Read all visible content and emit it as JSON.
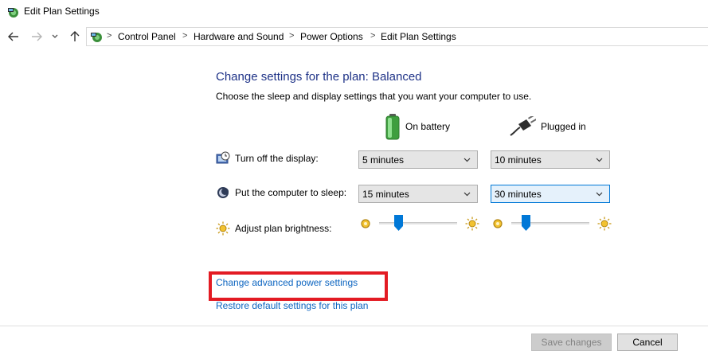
{
  "window": {
    "title": "Edit Plan Settings"
  },
  "nav": {
    "back_icon": "arrow-left-icon",
    "forward_icon": "arrow-right-icon",
    "recent_icon": "chevron-down-icon",
    "up_icon": "arrow-up-icon",
    "sep": ">",
    "breadcrumbs": [
      "Control Panel",
      "Hardware and Sound",
      "Power Options",
      "Edit Plan Settings"
    ]
  },
  "main": {
    "heading": "Change settings for the plan: Balanced",
    "subheading": "Choose the sleep and display settings that you want your computer to use.",
    "columns": {
      "battery": "On battery",
      "plugged": "Plugged in"
    },
    "rows": {
      "display": {
        "label": "Turn off the display:",
        "battery": "5 minutes",
        "plugged": "10 minutes"
      },
      "sleep": {
        "label": "Put the computer to sleep:",
        "battery": "15 minutes",
        "plugged": "30 minutes"
      },
      "brightness": {
        "label": "Adjust plan brightness:",
        "battery_level": 0.25,
        "plugged_level": 0.19
      }
    },
    "links": {
      "advanced": "Change advanced power settings",
      "restore": "Restore default settings for this plan"
    }
  },
  "footer": {
    "save": "Save changes",
    "cancel": "Cancel"
  },
  "colors": {
    "heading": "#1e3287",
    "link": "#0b64c0",
    "highlight": "#e31b23",
    "slider_thumb": "#0078d7"
  }
}
